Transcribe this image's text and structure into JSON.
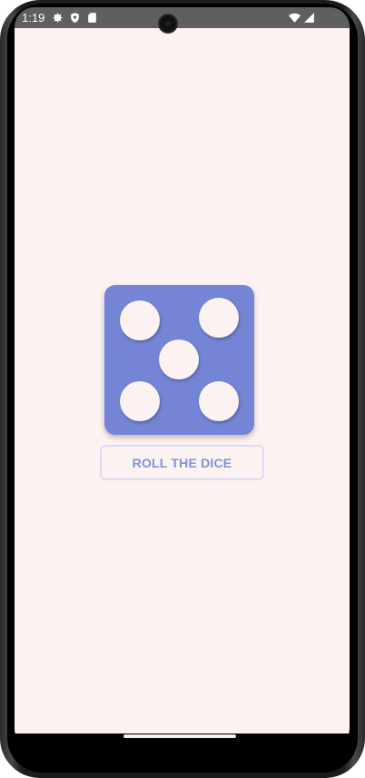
{
  "status_bar": {
    "time": "1:19",
    "left_icons": [
      "gear-icon",
      "shield-icon",
      "sd-card-icon"
    ],
    "right_icons": [
      "wifi-icon",
      "signal-icon"
    ]
  },
  "app": {
    "background_color": "#fdf2f2",
    "dice": {
      "value": 5,
      "color": "#7385d4",
      "pip_color": "#fdf2f2"
    },
    "roll_button_label": "ROLL THE DICE",
    "accent_color": "#7f92d8"
  }
}
